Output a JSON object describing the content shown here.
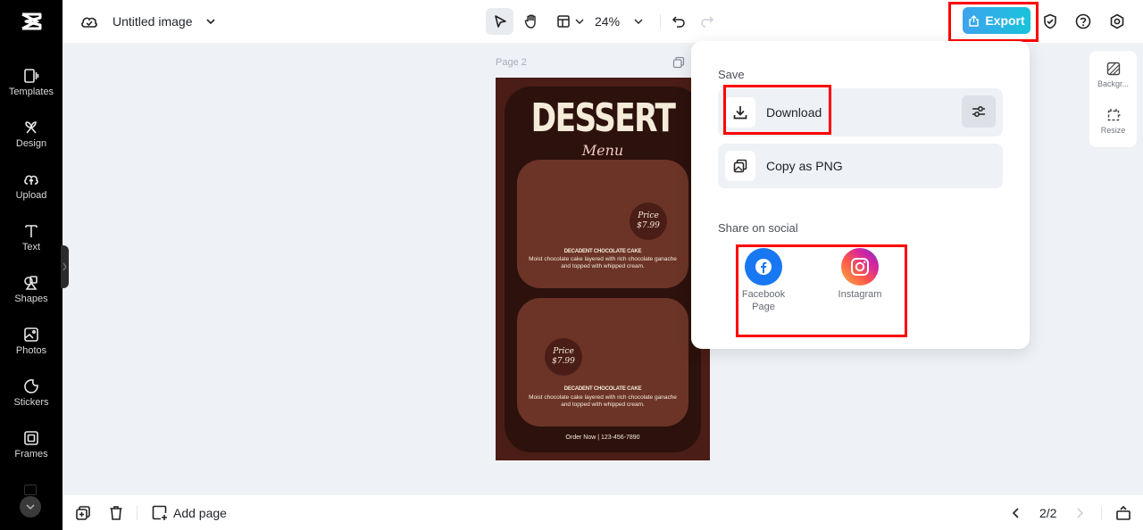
{
  "sidebar": {
    "logo": "capcut-logo",
    "items": [
      {
        "label": "Templates",
        "icon": "templates-icon"
      },
      {
        "label": "Design",
        "icon": "design-icon"
      },
      {
        "label": "Upload",
        "icon": "upload-cloud-icon"
      },
      {
        "label": "Text",
        "icon": "text-icon"
      },
      {
        "label": "Shapes",
        "icon": "shapes-icon"
      },
      {
        "label": "Photos",
        "icon": "photos-icon"
      },
      {
        "label": "Stickers",
        "icon": "stickers-icon"
      },
      {
        "label": "Frames",
        "icon": "frames-icon"
      }
    ]
  },
  "header": {
    "title": "Untitled image",
    "zoom": "24%",
    "export_label": "Export"
  },
  "canvas": {
    "page_label": "Page 2",
    "poster": {
      "title": "DESSERT",
      "subtitle": "Menu",
      "items": [
        {
          "price_label": "Price",
          "price": "$7.99",
          "name": "DECADENT CHOCOLATE CAKE",
          "description": "Moist chocolate cake layered with rich chocolate ganache and topped with whipped cream."
        },
        {
          "price_label": "Price",
          "price": "$7.99",
          "name": "DECADENT CHOCOLATE CAKE",
          "description": "Moist chocolate cake layered with rich chocolate ganache and topped with whipped cream."
        }
      ],
      "footer": "Order Now  |  123-456-7890"
    }
  },
  "export_popup": {
    "save_title": "Save",
    "download_label": "Download",
    "copy_label": "Copy as PNG",
    "share_title": "Share on social",
    "social": [
      {
        "label": "Facebook Page",
        "color": "#1877f2"
      },
      {
        "label": "Instagram",
        "color": "#d62976"
      }
    ]
  },
  "right_panel": {
    "items": [
      {
        "label": "Backgr..."
      },
      {
        "label": "Resize"
      }
    ]
  },
  "bottom_bar": {
    "add_page_label": "Add page",
    "page_indicator": "2/2"
  },
  "colors": {
    "accent_start": "#3ea3ee",
    "accent_end": "#19c3db",
    "highlight": "#ff0000"
  }
}
